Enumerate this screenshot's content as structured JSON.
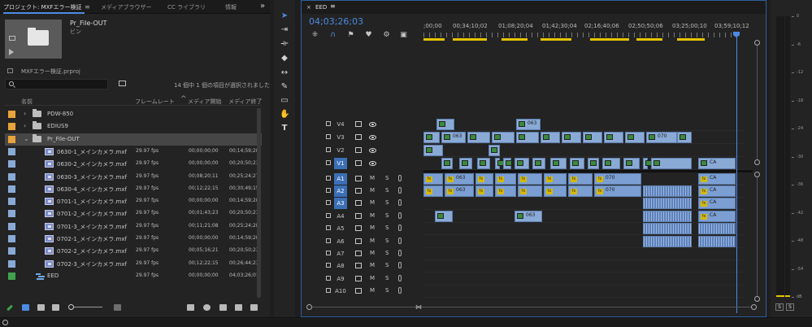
{
  "project": {
    "tabs": [
      "プロジェクト: MXFエラー検証",
      "メディアブラウザー",
      "CC ライブラリ",
      "情報"
    ],
    "menu_glyph": "≡",
    "more_glyph": "»",
    "bin_name": "Pr_File-OUT",
    "bin_type": "ビン",
    "project_file": "MXFエラー検証.prproj",
    "search_value": "",
    "selection_status": "14 個中 1 個の項目が選択されました",
    "columns": [
      "名前",
      "フレームレート",
      "メディア開始",
      "メディア終了"
    ],
    "rows": [
      {
        "type": "folder",
        "name": "PDW-850",
        "fps": "",
        "start": "",
        "end": "",
        "color": "#e8a33d",
        "indent": 0,
        "expanded": false
      },
      {
        "type": "folder",
        "name": "EDIUS9",
        "fps": "",
        "start": "",
        "end": "",
        "color": "#e8a33d",
        "indent": 0,
        "expanded": false
      },
      {
        "type": "folder",
        "name": "Pr_File-OUT",
        "fps": "",
        "start": "",
        "end": "",
        "color": "#e8a33d",
        "indent": 0,
        "expanded": true,
        "selected": true
      },
      {
        "type": "clip",
        "name": "0630-1_メインカメラ.mxf",
        "fps": "29.97 fps",
        "start": "00;00;00;00",
        "end": "00;14;59;28",
        "color": "#8aaad6"
      },
      {
        "type": "clip",
        "name": "0630-2_メインカメラ.mxf",
        "fps": "29.97 fps",
        "start": "00;00;00;00",
        "end": "00;20;50;23",
        "color": "#8aaad6"
      },
      {
        "type": "clip",
        "name": "0630-3_メインカメラ.mxf",
        "fps": "29.97 fps",
        "start": "00;08;20;11",
        "end": "00;25;24;27",
        "color": "#8aaad6"
      },
      {
        "type": "clip",
        "name": "0630-4_メインカメラ.mxf",
        "fps": "29.97 fps",
        "start": "00;12;22;15",
        "end": "00;30;49;15",
        "color": "#8aaad6"
      },
      {
        "type": "clip",
        "name": "0701-1_メインカメラ.mxf",
        "fps": "29.97 fps",
        "start": "00;00;00;00",
        "end": "00;14;59;28",
        "color": "#8aaad6"
      },
      {
        "type": "clip",
        "name": "0701-2_メインカメラ.mxf",
        "fps": "29.97 fps",
        "start": "00;01;43;23",
        "end": "00;20;50;23",
        "color": "#8aaad6"
      },
      {
        "type": "clip",
        "name": "0701-3_メインカメラ.mxf",
        "fps": "29.97 fps",
        "start": "00;11;21;08",
        "end": "00;25;24;28",
        "color": "#8aaad6"
      },
      {
        "type": "clip",
        "name": "0702-1_メインカメラ.mxf",
        "fps": "29.97 fps",
        "start": "00;00;00;00",
        "end": "00;14;59;28",
        "color": "#8aaad6"
      },
      {
        "type": "clip",
        "name": "0702-2_メインカメラ.mxf",
        "fps": "29.97 fps",
        "start": "00;05;16;21",
        "end": "00;20;50;23",
        "color": "#8aaad6"
      },
      {
        "type": "clip",
        "name": "0702-3_メインカメラ.mxf",
        "fps": "29.97 fps",
        "start": "00;12;22;15",
        "end": "00;26;44;23",
        "color": "#8aaad6"
      },
      {
        "type": "sequence",
        "name": "EED",
        "fps": "29.97 fps",
        "start": "00;00;00;00",
        "end": "04;03;26;01",
        "color": "#3fa34d"
      }
    ],
    "bottom_icons": [
      "pencil-icon",
      "list-view-icon",
      "icon-view-icon",
      "freeform-view-icon",
      "zoom-slider",
      "sort-icon",
      "automate-icon",
      "find-icon",
      "new-bin-icon",
      "new-item-icon",
      "clear-icon"
    ]
  },
  "tools": [
    "selection-tool",
    "track-select-tool",
    "ripple-edit-tool",
    "razor-tool",
    "slip-tool",
    "pen-tool",
    "rectangle-tool",
    "hand-tool",
    "type-tool"
  ],
  "timeline": {
    "close_glyph": "×",
    "sequence_name": "EED",
    "menu_glyph": "≡",
    "timecode": "04;03;26;03",
    "ruler_labels": [
      ";00;00",
      "00;34;10;02",
      "01;08;20;04",
      "01;42;30;04",
      "02;16;40;06",
      "02;50;50;06",
      "03;25;00;10",
      "03;59;10;12"
    ],
    "video_tracks": [
      "V4",
      "V3",
      "V2",
      "V1"
    ],
    "audio_tracks": [
      "A1",
      "A2",
      "A3",
      "A4",
      "A5",
      "A6",
      "A7",
      "A8",
      "A9",
      "A10"
    ],
    "targeted": [
      "V1",
      "A1",
      "A2",
      "A3"
    ],
    "m_label": "M",
    "s_label": "S",
    "clip_labels": {
      "a": "063",
      "b": "063",
      "c": "070",
      "d": "CA"
    }
  },
  "meter": {
    "scale": [
      "0",
      "-6",
      "-12",
      "-18",
      "-24",
      "-30",
      "-36",
      "-42",
      "-48",
      "-54",
      "dB"
    ],
    "solo": [
      "S",
      "S"
    ]
  }
}
